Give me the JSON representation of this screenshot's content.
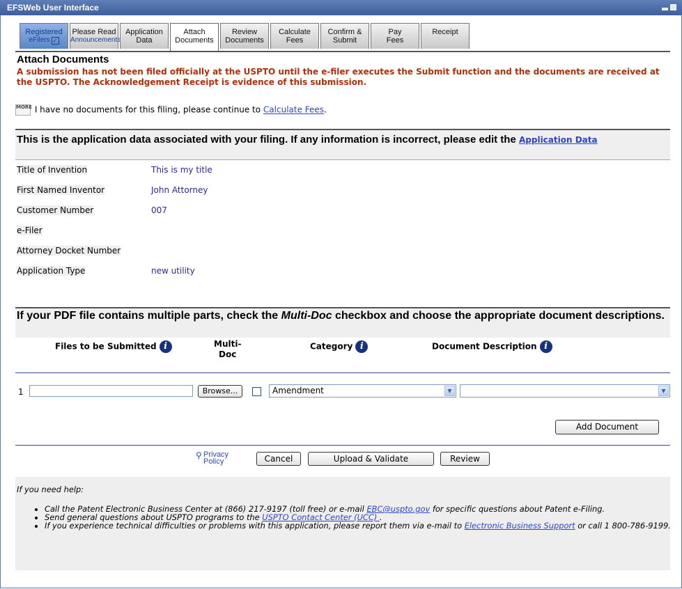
{
  "window": {
    "title": "EFSWeb User Interface"
  },
  "tabs": [
    {
      "line1": "Registered",
      "line2": "eFilers",
      "state": "done"
    },
    {
      "line1": "Please Read",
      "line2": "Announcements",
      "state": "small"
    },
    {
      "line1": "Application",
      "line2": "Data",
      "state": "normal"
    },
    {
      "line1": "Attach",
      "line2": "Documents",
      "state": "active"
    },
    {
      "line1": "Review",
      "line2": "Documents",
      "state": "normal"
    },
    {
      "line1": "Calculate",
      "line2": "Fees",
      "state": "normal"
    },
    {
      "line1": "Confirm &",
      "line2": "Submit",
      "state": "normal"
    },
    {
      "line1": "Pay",
      "line2": "Fees",
      "state": "normal"
    },
    {
      "line1": "Receipt",
      "line2": "",
      "state": "normal"
    }
  ],
  "page": {
    "title": "Attach Documents",
    "warning": "A submission has not been filed officially at the USPTO until the e-filer executes the Submit function and the documents are received at the USPTO. The Acknowledgement Receipt is evidence of this submission.",
    "more_icon": "MORE",
    "no_docs_text": "I have no documents for this filing, please continue to",
    "no_docs_link": "Calculate Fees",
    "no_docs_end": "."
  },
  "app_data": {
    "header": "This is the application data associated with your filing. If any information is incorrect, please edit the",
    "header_link": "Application Data",
    "rows": [
      {
        "label": "Title of Invention",
        "value": "This is my title"
      },
      {
        "label": "First Named Inventor",
        "value": "John Attorney"
      },
      {
        "label": "Customer Number",
        "value": "007"
      },
      {
        "label": "e-Filer",
        "value": ""
      },
      {
        "label": "Attorney Docket Number",
        "value": ""
      },
      {
        "label": "Application Type",
        "value": "new utility"
      }
    ]
  },
  "upload": {
    "header_pre": "If your PDF file contains multiple parts, check the ",
    "header_em": "Multi-Doc",
    "header_post": " checkbox and choose the appropriate document descriptions.",
    "col_files": "Files to be Submitted",
    "col_multi_1": "Multi-",
    "col_multi_2": "Doc",
    "col_category": "Category",
    "col_desc": "Document Description",
    "row_num": "1",
    "file_value": "",
    "browse_label": "Browse...",
    "category_value": "Amendment",
    "description_value": "",
    "add_label": "Add Document"
  },
  "actions": {
    "privacy_1": "Privacy",
    "privacy_2": "Policy",
    "cancel": "Cancel",
    "upload": "Upload & Validate",
    "review": "Review"
  },
  "help": {
    "intro": "If you need help:",
    "item1_pre": "Call the Patent Electronic Business Center at (866) 217-9197 (toll free) or e-mail ",
    "item1_link": "EBC@uspto.gov",
    "item1_post": " for specific questions about Patent e-Filing.",
    "item2_pre": "Send general questions about USPTO programs to the ",
    "item2_link": "USPTO Contact Center (UCC) ",
    "item2_post": ".",
    "item3_pre": "If you experience technical difficulties or problems with this application, please report them via e-mail to ",
    "item3_link": "Electronic Business Support",
    "item3_post": " or call 1 800-786-9199."
  },
  "colors": {
    "titlebar": "#4a6aa8",
    "warning": "#b02f08",
    "link": "#2a46c4",
    "value": "#2a2a8f",
    "panel": "#efefef"
  }
}
